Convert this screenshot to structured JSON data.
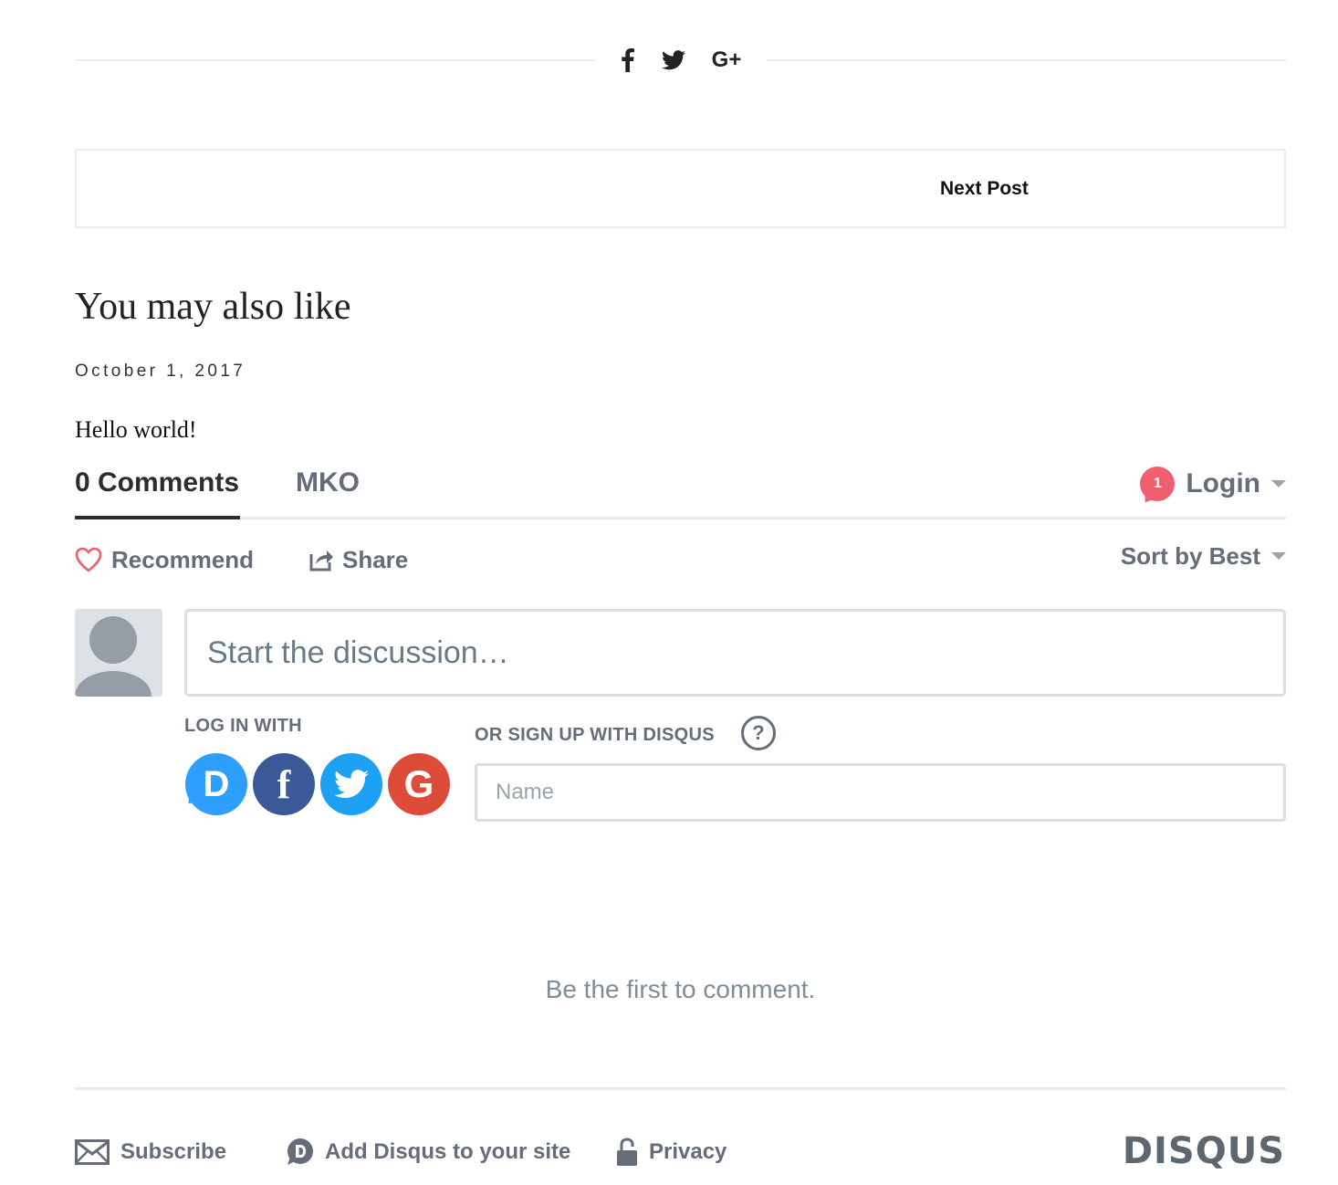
{
  "share_icons": [
    "facebook-icon",
    "twitter-icon",
    "google-plus-icon"
  ],
  "google_plus_label": "G+",
  "post_nav": {
    "next_label": "Next Post"
  },
  "related": {
    "title": "You may also like",
    "date": "October 1, 2017",
    "post_title": "Hello world!"
  },
  "disqus": {
    "tabs": {
      "comments": "0 Comments",
      "forum": "MKO"
    },
    "login": {
      "badge_count": "1",
      "label": "Login"
    },
    "actions": {
      "recommend": "Recommend",
      "share": "Share",
      "sort": "Sort by Best"
    },
    "composer": {
      "placeholder": "Start the discussion…"
    },
    "login_with": "LOG IN WITH",
    "social_logins": [
      {
        "name": "Disqus",
        "glyph": "D",
        "color": "#2e9fff"
      },
      {
        "name": "Facebook",
        "glyph": "f",
        "color": "#3b5998"
      },
      {
        "name": "Twitter",
        "glyph": "twitter-bird",
        "color": "#1da1f2"
      },
      {
        "name": "Google",
        "glyph": "G",
        "color": "#dd4b39"
      }
    ],
    "signup_label": "OR SIGN UP WITH DISQUS",
    "help_glyph": "?",
    "name_placeholder": "Name",
    "empty_message": "Be the first to comment.",
    "footer": {
      "subscribe": "Subscribe",
      "add_disqus": "Add Disqus to your site",
      "privacy": "Privacy",
      "logo": "DISQUS"
    },
    "accent_color": "#f05f70",
    "text_muted_color": "#656c7a"
  }
}
